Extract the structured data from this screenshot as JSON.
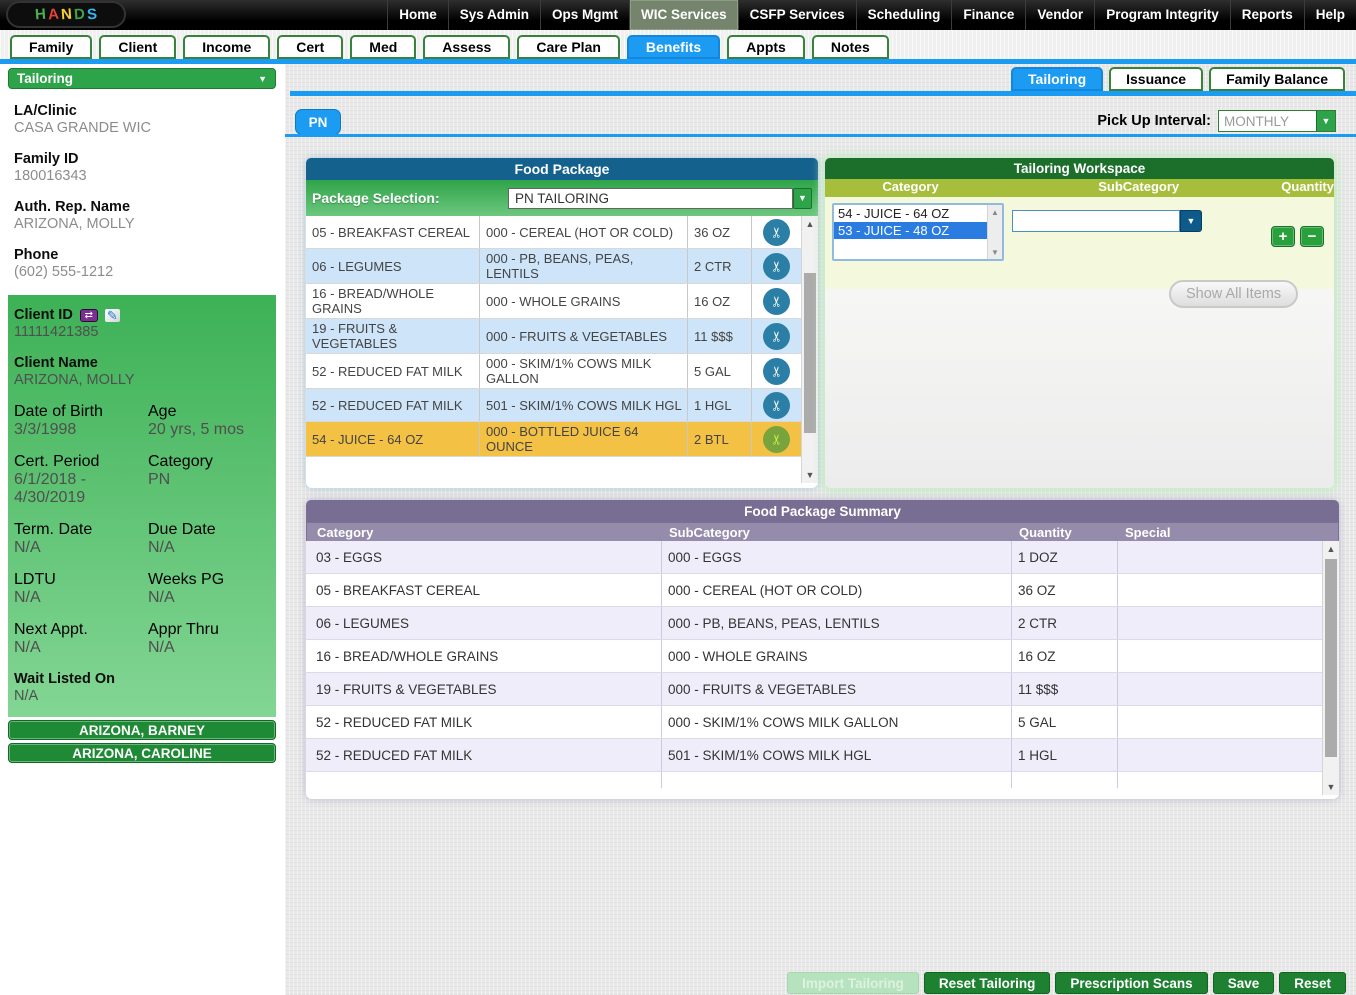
{
  "logo": {
    "letters": [
      "H",
      "A",
      "N",
      "D",
      "S"
    ]
  },
  "nav": {
    "items": [
      {
        "label": "Home"
      },
      {
        "label": "Sys Admin"
      },
      {
        "label": "Ops Mgmt"
      },
      {
        "label": "WIC Services"
      },
      {
        "label": "CSFP Services"
      },
      {
        "label": "Scheduling"
      },
      {
        "label": "Finance"
      },
      {
        "label": "Vendor"
      },
      {
        "label": "Program Integrity"
      },
      {
        "label": "Reports"
      },
      {
        "label": "Help"
      }
    ]
  },
  "tabs": {
    "items": [
      {
        "label": "Family"
      },
      {
        "label": "Client"
      },
      {
        "label": "Income"
      },
      {
        "label": "Cert"
      },
      {
        "label": "Med"
      },
      {
        "label": "Assess"
      },
      {
        "label": "Care Plan"
      },
      {
        "label": "Benefits"
      },
      {
        "label": "Appts"
      },
      {
        "label": "Notes"
      }
    ]
  },
  "sidebar": {
    "header": "Tailoring",
    "info": [
      {
        "label": "LA/Clinic",
        "value": "CASA GRANDE WIC"
      },
      {
        "label": "Family ID",
        "value": "180016343"
      },
      {
        "label": "Auth. Rep. Name",
        "value": "ARIZONA, MOLLY"
      },
      {
        "label": "Phone",
        "value": "(602) 555-1212"
      }
    ],
    "client": {
      "id_label": "Client ID",
      "id_value": "11111421385",
      "name_label": "Client Name",
      "name_value": "ARIZONA, MOLLY",
      "pairs": [
        {
          "l1": "Date of Birth",
          "v1": "3/3/1998",
          "l2": "Age",
          "v2": "20 yrs, 5 mos"
        },
        {
          "l1": "Cert. Period",
          "v1": "6/1/2018 - 4/30/2019",
          "l2": "Category",
          "v2": "PN"
        },
        {
          "l1": "Term. Date",
          "v1": "N/A",
          "l2": "Due Date",
          "v2": "N/A"
        },
        {
          "l1": "LDTU",
          "v1": "N/A",
          "l2": "Weeks PG",
          "v2": "N/A"
        },
        {
          "l1": "Next Appt.",
          "v1": "N/A",
          "l2": "Appr Thru",
          "v2": "N/A"
        }
      ],
      "wait_label": "Wait Listed On",
      "wait_value": "N/A"
    },
    "members": [
      {
        "name": "ARIZONA, BARNEY"
      },
      {
        "name": "ARIZONA, CAROLINE"
      }
    ]
  },
  "subtabs": [
    {
      "label": "Tailoring"
    },
    {
      "label": "Issuance"
    },
    {
      "label": "Family Balance"
    }
  ],
  "pn_tab": "PN",
  "pickup": {
    "label": "Pick Up Interval:",
    "value": "MONTHLY"
  },
  "food_package": {
    "title": "Food Package",
    "selection_label": "Package Selection:",
    "selection_value": "PN TAILORING",
    "rows": [
      {
        "category": "05 - BREAKFAST CEREAL",
        "subcategory": "000 - CEREAL (HOT OR COLD)",
        "quantity": "36 OZ"
      },
      {
        "category": "06 - LEGUMES",
        "subcategory": "000 - PB, BEANS, PEAS, LENTILS",
        "quantity": "2 CTR"
      },
      {
        "category": "16 - BREAD/WHOLE GRAINS",
        "subcategory": "000 - WHOLE GRAINS",
        "quantity": "16 OZ"
      },
      {
        "category": "19 - FRUITS & VEGETABLES",
        "subcategory": "000 - FRUITS & VEGETABLES",
        "quantity": "11 $$$"
      },
      {
        "category": "52 - REDUCED FAT MILK",
        "subcategory": "000 - SKIM/1% COWS MILK GALLON",
        "quantity": "5 GAL"
      },
      {
        "category": "52 - REDUCED FAT MILK",
        "subcategory": "501 - SKIM/1% COWS MILK HGL",
        "quantity": "1 HGL"
      },
      {
        "category": "54 - JUICE - 64 OZ",
        "subcategory": "000 - BOTTLED JUICE 64 OUNCE",
        "quantity": "2 BTL"
      }
    ]
  },
  "workspace": {
    "title": "Tailoring Workspace",
    "columns": {
      "category": "Category",
      "subcategory": "SubCategory",
      "quantity": "Quantity"
    },
    "category_options": [
      {
        "label": "54 - JUICE - 64 OZ"
      },
      {
        "label": "53 - JUICE - 48 OZ"
      }
    ],
    "plus": "+",
    "minus": "−",
    "show_all": "Show All Items"
  },
  "summary": {
    "title": "Food Package Summary",
    "columns": [
      "Category",
      "SubCategory",
      "Quantity",
      "Special"
    ],
    "rows": [
      {
        "category": "03 - EGGS",
        "subcategory": "000 - EGGS",
        "quantity": "1 DOZ",
        "special": ""
      },
      {
        "category": "05 - BREAKFAST CEREAL",
        "subcategory": "000 - CEREAL (HOT OR COLD)",
        "quantity": "36 OZ",
        "special": ""
      },
      {
        "category": "06 - LEGUMES",
        "subcategory": "000 - PB, BEANS, PEAS, LENTILS",
        "quantity": "2 CTR",
        "special": ""
      },
      {
        "category": "16 - BREAD/WHOLE GRAINS",
        "subcategory": "000 - WHOLE GRAINS",
        "quantity": "16 OZ",
        "special": ""
      },
      {
        "category": "19 - FRUITS & VEGETABLES",
        "subcategory": "000 - FRUITS & VEGETABLES",
        "quantity": "11 $$$",
        "special": ""
      },
      {
        "category": "52 - REDUCED FAT MILK",
        "subcategory": "000 - SKIM/1% COWS MILK GALLON",
        "quantity": "5 GAL",
        "special": ""
      },
      {
        "category": "52 - REDUCED FAT MILK",
        "subcategory": "501 - SKIM/1% COWS MILK HGL",
        "quantity": "1 HGL",
        "special": ""
      }
    ]
  },
  "footer": {
    "buttons": [
      {
        "label": "Import Tailoring",
        "disabled": true
      },
      {
        "label": "Reset Tailoring",
        "disabled": false
      },
      {
        "label": "Prescription Scans",
        "disabled": false
      },
      {
        "label": "Save",
        "disabled": false
      },
      {
        "label": "Reset",
        "disabled": false
      }
    ]
  },
  "colors": {
    "accent_blue": "#1B9BF2",
    "green": "#2EA44A",
    "dark_green": "#1C6F2B",
    "olive": "#A7BE3C",
    "fp_header_blue": "#15618E",
    "summary_purple": "#786D92",
    "row_blue": "#CDE4F9",
    "row_lavender": "#EFEDF9",
    "highlight_amber": "#F3C144",
    "scissors_teal": "#2B7FA6"
  }
}
